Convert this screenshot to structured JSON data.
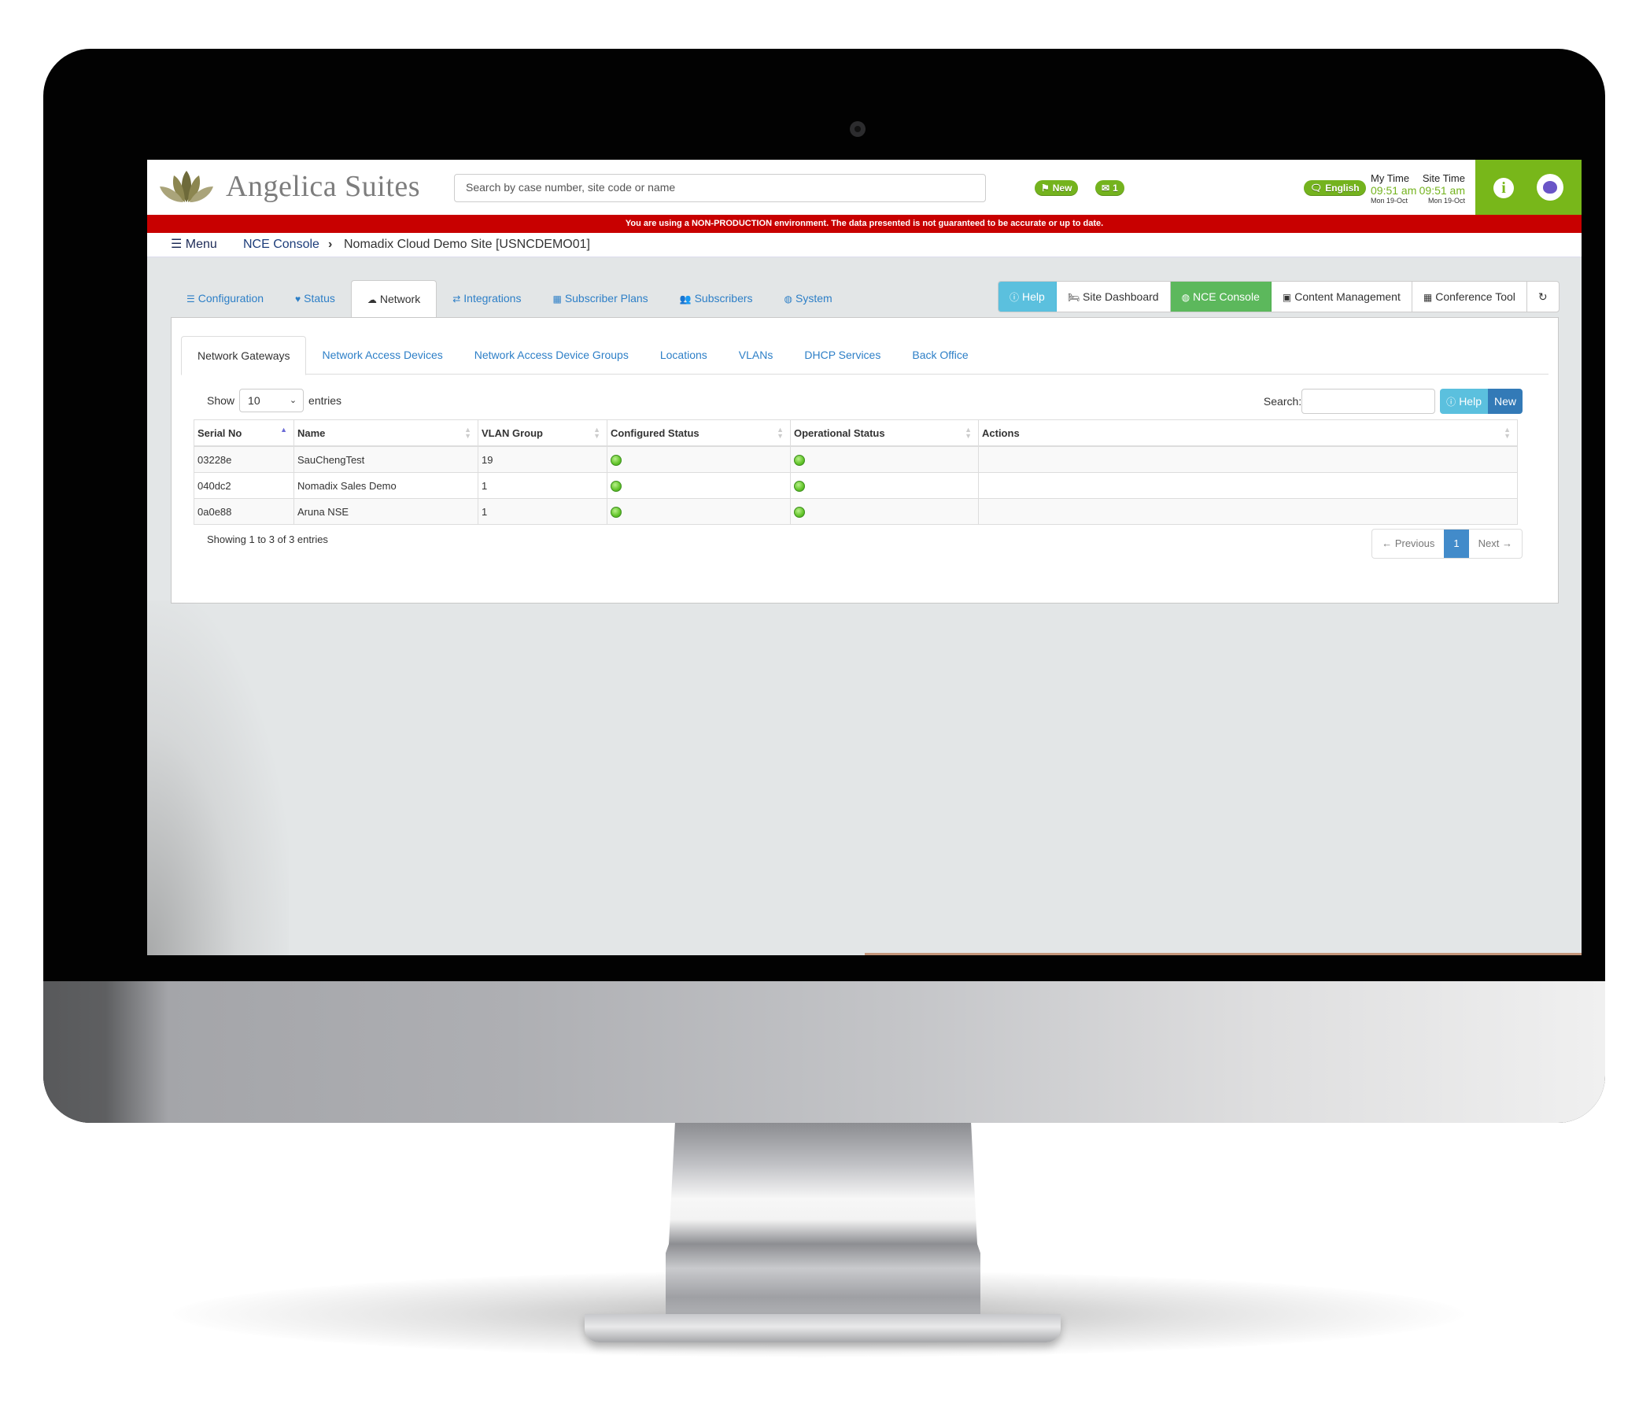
{
  "header": {
    "brand": "Angelica Suites",
    "search_placeholder": "Search by case number, site code or name",
    "new_label": "New",
    "mail_count": "1",
    "language": "English",
    "my_time_label": "My Time",
    "site_time_label": "Site Time",
    "my_time": "09:51 am",
    "site_time": "09:51 am",
    "my_date": "Mon 19-Oct",
    "site_date": "Mon 19-Oct",
    "accent_color": "#78b71a"
  },
  "warning": "You are using a NON-PRODUCTION environment. The data presented is not guaranteed to be accurate or up to date.",
  "breadcrumb": {
    "menu": "Menu",
    "items": [
      "NCE Console",
      "Nomadix Cloud Demo Site [USNCDEMO01]"
    ]
  },
  "main_tabs": [
    {
      "label": "Configuration",
      "icon": "list-icon"
    },
    {
      "label": "Status",
      "icon": "heartbeat-icon"
    },
    {
      "label": "Network",
      "icon": "cloud-icon",
      "active": true
    },
    {
      "label": "Integrations",
      "icon": "exchange-icon"
    },
    {
      "label": "Subscriber Plans",
      "icon": "calendar-check-icon"
    },
    {
      "label": "Subscribers",
      "icon": "users-icon"
    },
    {
      "label": "System",
      "icon": "globe-icon"
    }
  ],
  "toolbar": {
    "help": "Help",
    "site_dashboard": "Site Dashboard",
    "nce_console": "NCE Console",
    "content_management": "Content Management",
    "conference_tool": "Conference Tool"
  },
  "sub_tabs": [
    "Network Gateways",
    "Network Access Devices",
    "Network Access Device Groups",
    "Locations",
    "VLANs",
    "DHCP Services",
    "Back Office"
  ],
  "table_controls": {
    "show_label": "Show",
    "page_size": "10",
    "entries_label": "entries",
    "search_label": "Search:",
    "help": "Help",
    "new": "New"
  },
  "table": {
    "columns": [
      "Serial No",
      "Name",
      "VLAN Group",
      "Configured Status",
      "Operational Status",
      "Actions"
    ],
    "rows": [
      {
        "serial": "03228e",
        "name": "SauChengTest",
        "vlan": "19",
        "configured": "ok",
        "operational": "ok",
        "actions": ""
      },
      {
        "serial": "040dc2",
        "name": "Nomadix Sales Demo",
        "vlan": "1",
        "configured": "ok",
        "operational": "ok",
        "actions": ""
      },
      {
        "serial": "0a0e88",
        "name": "Aruna NSE",
        "vlan": "1",
        "configured": "ok",
        "operational": "ok",
        "actions": ""
      }
    ]
  },
  "pagination": {
    "info": "Showing 1 to 3 of 3 entries",
    "previous": "← Previous",
    "current": "1",
    "next": "Next →"
  }
}
